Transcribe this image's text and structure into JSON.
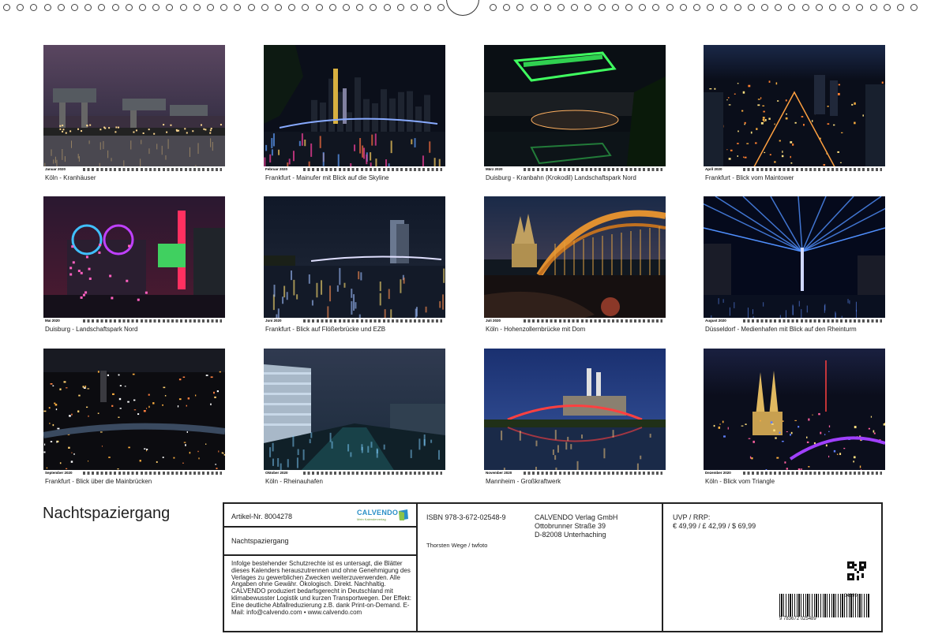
{
  "binding": {
    "ring_count": 67
  },
  "calendar_title": "Nachtspaziergang",
  "months": [
    {
      "month_label": "Januar 2020",
      "caption": "Köln - Kranhäuser",
      "scene": "cranes"
    },
    {
      "month_label": "Februar 2020",
      "caption": "Frankfurt - Mainufer mit Blick auf die Skyline",
      "scene": "skyline-bridge"
    },
    {
      "month_label": "März 2020",
      "caption": "Duisburg - Kranbahn (Krokodil) Landschaftspark Nord",
      "scene": "green-crane"
    },
    {
      "month_label": "April 2020",
      "caption": "Frankfurt - Blick vom Maintower",
      "scene": "city-above"
    },
    {
      "month_label": "Mai 2020",
      "caption": "Duisburg - Landschaftspark Nord",
      "scene": "industrial"
    },
    {
      "month_label": "Juni 2020",
      "caption": "Frankfurt - Blick auf Flößerbrücke und EZB",
      "scene": "bridge-tower"
    },
    {
      "month_label": "Juli 2020",
      "caption": "Köln - Hohenzollernbrücke mit Dom",
      "scene": "arch-bridge"
    },
    {
      "month_label": "August 2020",
      "caption": "Düsseldorf - Medienhafen mit Blick auf den Rheinturm",
      "scene": "light-beams"
    },
    {
      "month_label": "September 2020",
      "caption": "Frankfurt - Blick über die Mainbrücken",
      "scene": "city-aerial"
    },
    {
      "month_label": "Oktober 2020",
      "caption": "Köln - Rheinauhafen",
      "scene": "harbour"
    },
    {
      "month_label": "November 2020",
      "caption": "Mannheim - Großkraftwerk",
      "scene": "power-plant"
    },
    {
      "month_label": "Dezember 2020",
      "caption": "Köln - Blick vom Triangle",
      "scene": "cathedral"
    }
  ],
  "info": {
    "article_no": "Artikel-Nr. 8004278",
    "logo_name": "CALVENDO",
    "logo_tagline": "Mein Kalenderverlag",
    "product_title": "Nachtspaziergang",
    "legal_text": "Infolge bestehender Schutzrechte ist es untersagt, die Blätter dieses Kalenders herauszutrennen und ohne Genehmigung des Verlages zu gewerblichen Zwecken weiterzuverwenden. Alle Angaben ohne Gewähr. Ökologisch. Direkt. Nachhaltig. CALVENDO produziert bedarfsgerecht in Deutschland mit klimabewusster Logistik und kurzen Transportwegen. Der Effekt: Eine deutliche Abfallreduzierung z.B. dank Print-on-Demand. E-Mail: info@calvendo.com • www.calvendo.com",
    "isbn": "ISBN 978-3-672-02548-9",
    "author": "Thorsten Wege / twfoto",
    "publisher_name": "CALVENDO Verlag GmbH",
    "publisher_street": "Ottobrunner Straße 39",
    "publisher_city": "D-82008 Unterhaching",
    "price_label": "UVP / RRP:",
    "price_values": "€ 49,99 / £ 42,99 / $ 69,99",
    "barcode_number": "9 783672 025489",
    "barcode_addon": "04999"
  }
}
